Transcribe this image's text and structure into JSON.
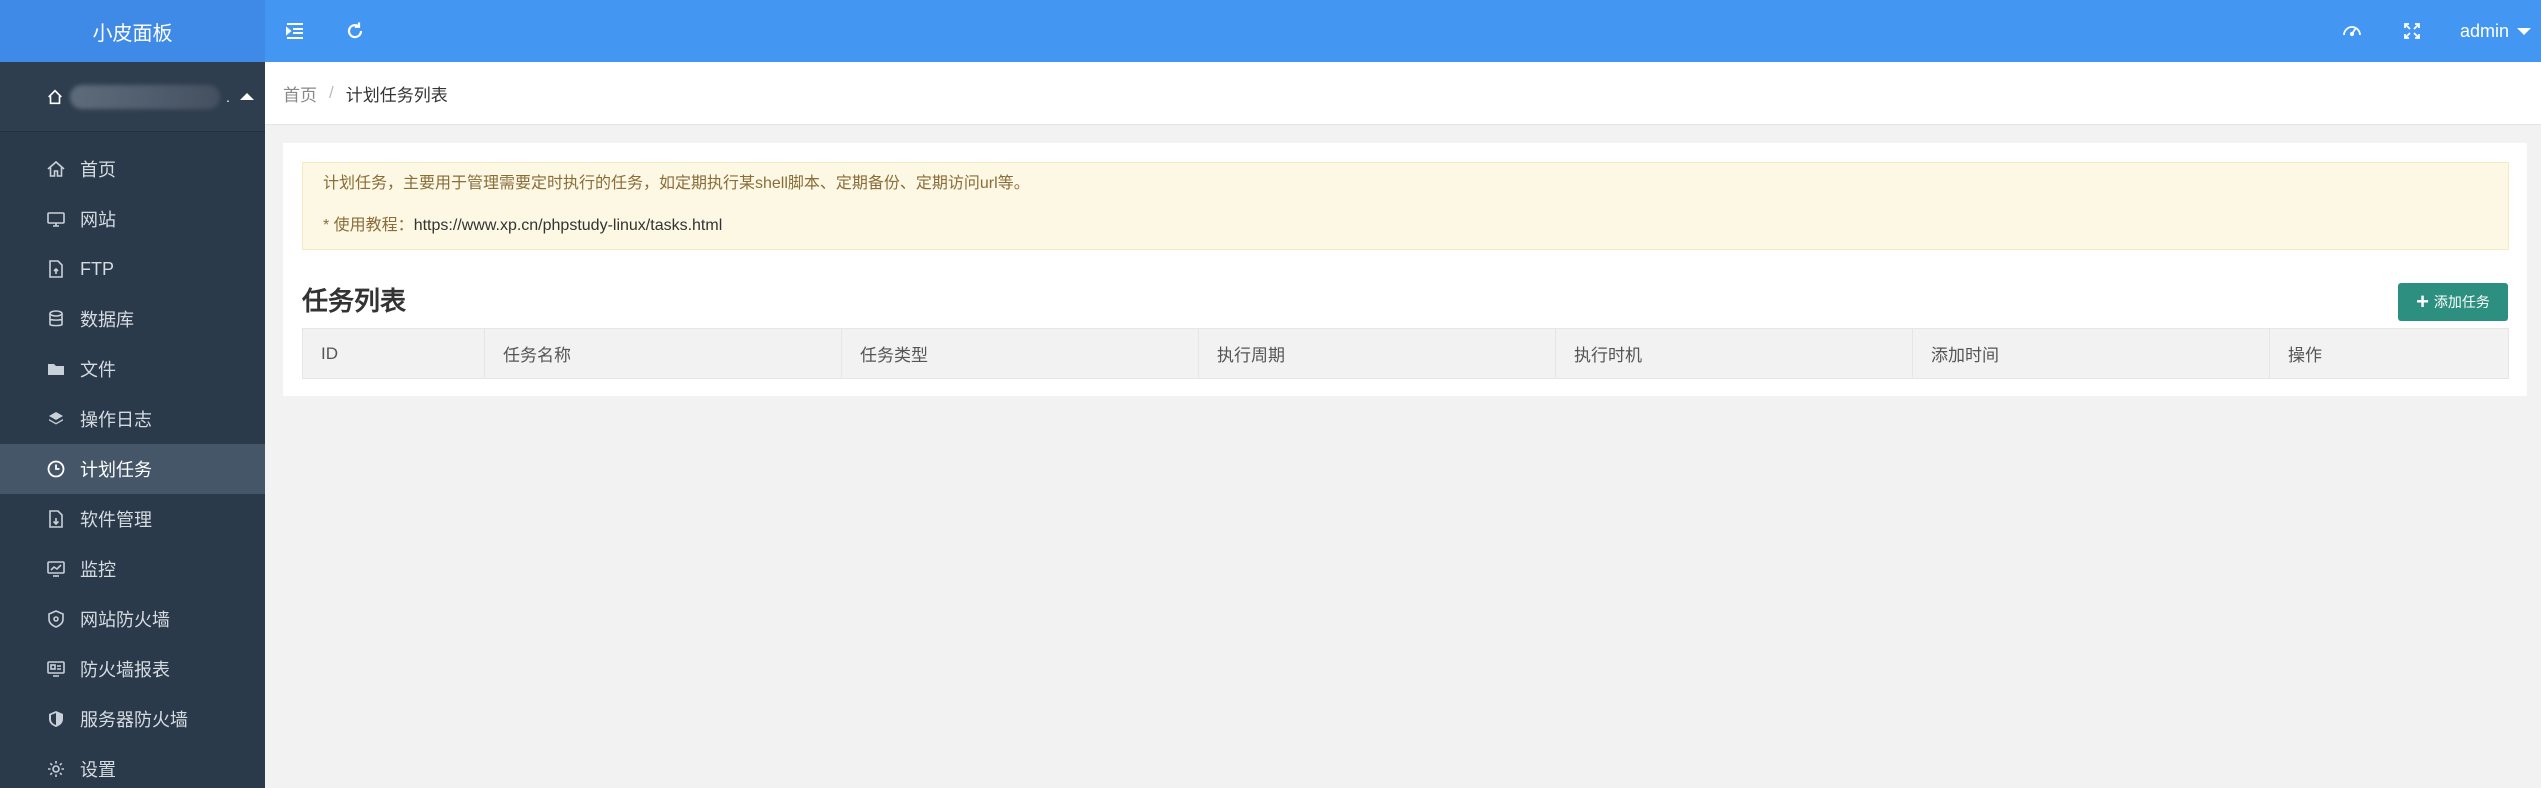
{
  "sidebar": {
    "logo": "小皮面板",
    "server_suffix": ".",
    "items": [
      {
        "label": "首页",
        "icon": "home-icon",
        "active": false
      },
      {
        "label": "网站",
        "icon": "monitor-icon",
        "active": false
      },
      {
        "label": "FTP",
        "icon": "ftp-file-icon",
        "active": false
      },
      {
        "label": "数据库",
        "icon": "database-icon",
        "active": false
      },
      {
        "label": "文件",
        "icon": "folder-icon",
        "active": false
      },
      {
        "label": "操作日志",
        "icon": "layers-icon",
        "active": false
      },
      {
        "label": "计划任务",
        "icon": "clock-icon",
        "active": true
      },
      {
        "label": "软件管理",
        "icon": "package-icon",
        "active": false
      },
      {
        "label": "监控",
        "icon": "chart-monitor-icon",
        "active": false
      },
      {
        "label": "网站防火墙",
        "icon": "shield-icon",
        "active": false
      },
      {
        "label": "防火墙报表",
        "icon": "report-icon",
        "active": false
      },
      {
        "label": "服务器防火墙",
        "icon": "server-shield-icon",
        "active": false
      },
      {
        "label": "设置",
        "icon": "gear-icon",
        "active": false
      }
    ]
  },
  "header": {
    "user": "admin"
  },
  "breadcrumb": {
    "home": "首页",
    "separator": "/",
    "current": "计划任务列表"
  },
  "tip": {
    "description": "计划任务，主要用于管理需要定时执行的任务，如定期执行某shell脚本、定期备份、定期访问url等。",
    "guide_label": "* 使用教程：",
    "guide_url": "https://www.xp.cn/phpstudy-linux/tasks.html"
  },
  "tasks": {
    "title": "任务列表",
    "add_button": "添加任务",
    "columns": [
      "ID",
      "任务名称",
      "任务类型",
      "执行周期",
      "执行时机",
      "添加时间",
      "操作"
    ]
  },
  "colors": {
    "header_bg": "#4397f2",
    "logo_bg": "#3f8ae6",
    "sidebar_bg": "#2b3a4a",
    "sidebar_active": "#455668",
    "add_button_bg": "#2d8f7f",
    "tip_bg": "#fcf8e3"
  }
}
